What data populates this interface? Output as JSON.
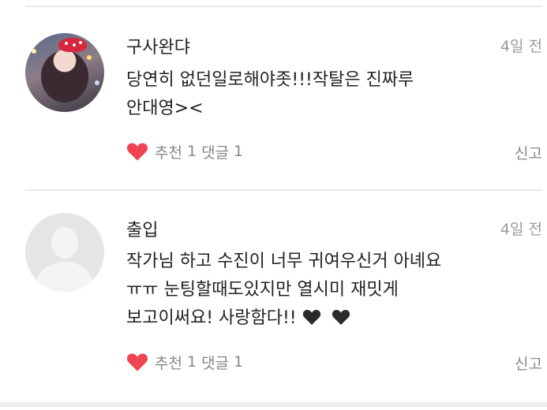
{
  "comments": [
    {
      "author": "구사완댜",
      "date": "4일 전",
      "lines": [
        "당연히 없던일로해야좃!!!작탈은 진짜루",
        "안대영><"
      ],
      "like_label": "추천",
      "like_count": "1",
      "reply_label": "댓글",
      "reply_count": "1",
      "report_label": "신고",
      "avatar": "profile-photo"
    },
    {
      "author": "출입",
      "date": "4일 전",
      "lines": [
        "작가님 하고 수진이 너무 귀여우신거 아녜요",
        "ㅠㅠ 눈팅할때도있지만 열시미 재밋게",
        "보고이써요! 사랑함다!!"
      ],
      "emoji": [
        "black-heart-icon",
        "black-heart-icon"
      ],
      "like_label": "추천",
      "like_count": "1",
      "reply_label": "댓글",
      "reply_count": "1",
      "report_label": "신고",
      "avatar": "default-avatar"
    }
  ],
  "colors": {
    "heart": "#f04452",
    "meta": "#888888",
    "divider": "#e8e8e8"
  }
}
